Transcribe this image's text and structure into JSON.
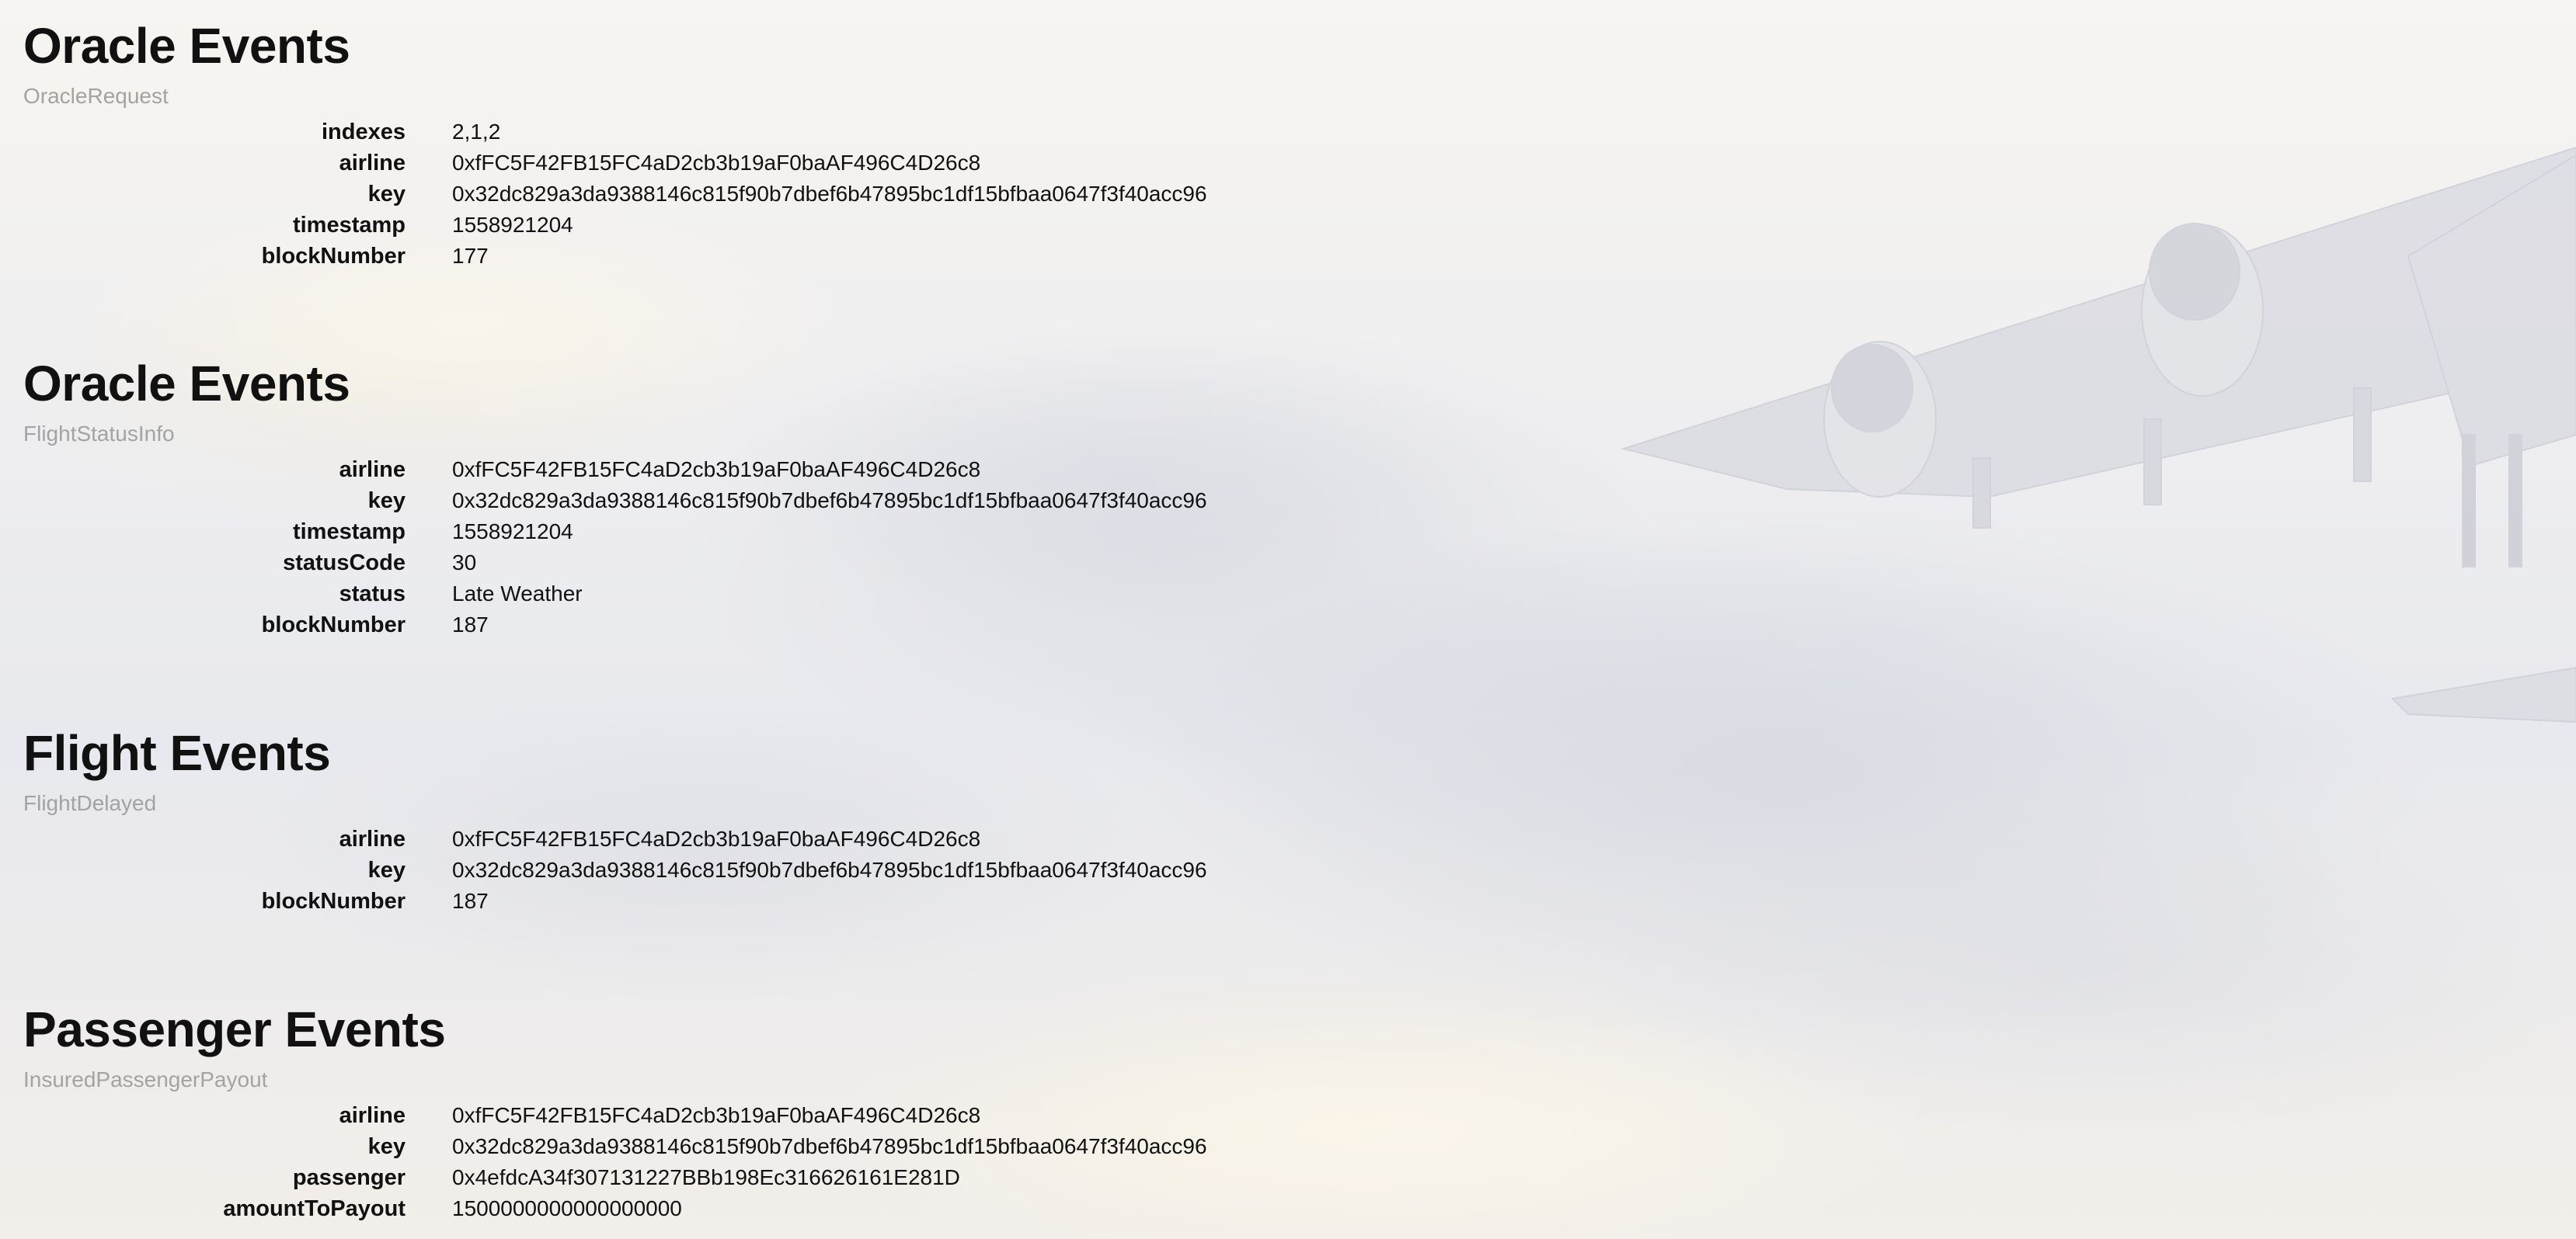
{
  "sections": [
    {
      "title": "Oracle Events",
      "event": "OracleRequest",
      "fields": [
        {
          "label": "indexes",
          "value": "2,1,2"
        },
        {
          "label": "airline",
          "value": "0xfFC5F42FB15FC4aD2cb3b19aF0baAF496C4D26c8"
        },
        {
          "label": "key",
          "value": "0x32dc829a3da9388146c815f90b7dbef6b47895bc1df15bfbaa0647f3f40acc96"
        },
        {
          "label": "timestamp",
          "value": "1558921204"
        },
        {
          "label": "blockNumber",
          "value": "177"
        }
      ]
    },
    {
      "title": "Oracle Events",
      "event": "FlightStatusInfo",
      "fields": [
        {
          "label": "airline",
          "value": "0xfFC5F42FB15FC4aD2cb3b19aF0baAF496C4D26c8"
        },
        {
          "label": "key",
          "value": "0x32dc829a3da9388146c815f90b7dbef6b47895bc1df15bfbaa0647f3f40acc96"
        },
        {
          "label": "timestamp",
          "value": "1558921204"
        },
        {
          "label": "statusCode",
          "value": "30"
        },
        {
          "label": "status",
          "value": "Late Weather"
        },
        {
          "label": "blockNumber",
          "value": "187"
        }
      ]
    },
    {
      "title": "Flight Events",
      "event": "FlightDelayed",
      "fields": [
        {
          "label": "airline",
          "value": "0xfFC5F42FB15FC4aD2cb3b19aF0baAF496C4D26c8"
        },
        {
          "label": "key",
          "value": "0x32dc829a3da9388146c815f90b7dbef6b47895bc1df15bfbaa0647f3f40acc96"
        },
        {
          "label": "blockNumber",
          "value": "187"
        }
      ]
    },
    {
      "title": "Passenger Events",
      "event": "InsuredPassengerPayout",
      "fields": [
        {
          "label": "airline",
          "value": "0xfFC5F42FB15FC4aD2cb3b19aF0baAF496C4D26c8"
        },
        {
          "label": "key",
          "value": "0x32dc829a3da9388146c815f90b7dbef6b47895bc1df15bfbaa0647f3f40acc96"
        },
        {
          "label": "passenger",
          "value": "0x4efdcA34f307131227BBb198Ec316626161E281D"
        },
        {
          "label": "amountToPayout",
          "value": "1500000000000000000"
        }
      ]
    }
  ],
  "background": {
    "image": "airplane-in-cloudy-sky"
  }
}
